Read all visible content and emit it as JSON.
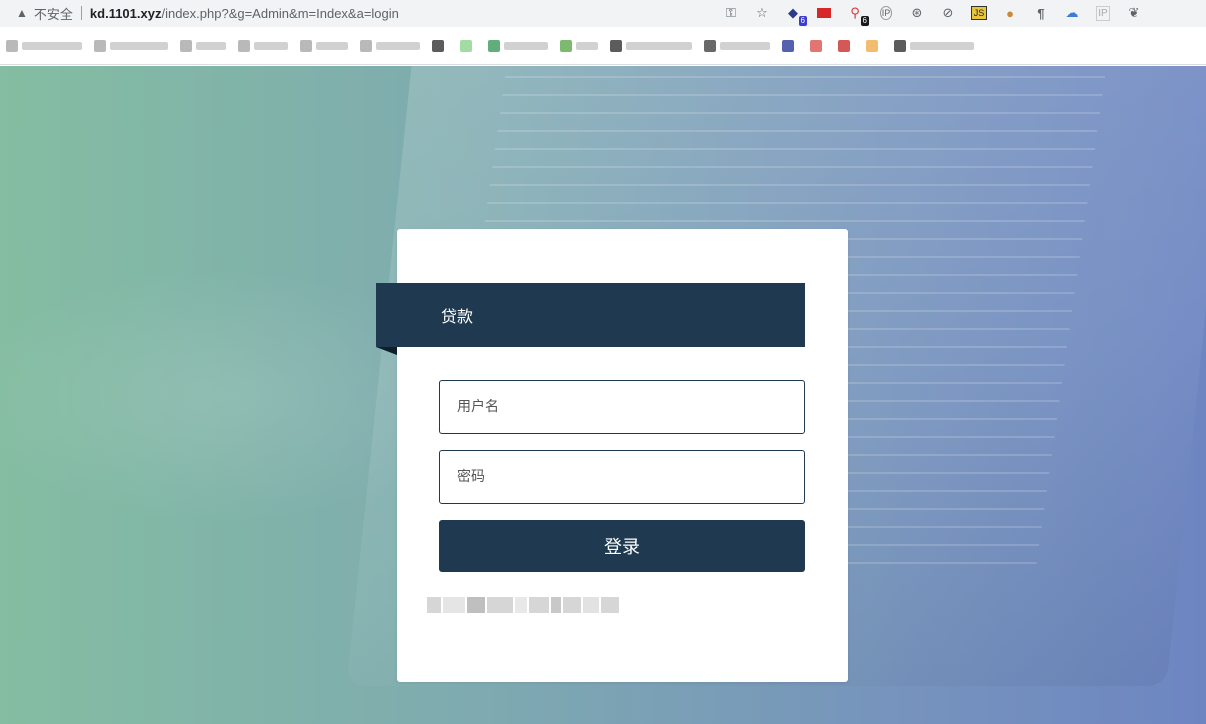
{
  "browser": {
    "security_label": "不安全",
    "url_host": "kd.1101.xyz",
    "url_path": "/index.php?&g=Admin&m=Index&a=login",
    "toolbar_icons": [
      "key-icon",
      "star-icon",
      "extension-diamond-icon",
      "extension-flag-icon",
      "extension-pin-icon",
      "extension-ip-icon",
      "extension-globe-icon",
      "extension-ban-icon",
      "extension-js-icon",
      "extension-cookie-icon",
      "extension-pilcrow-icon",
      "extension-cloud-icon",
      "extension-ip2-icon",
      "evernote-icon"
    ],
    "badge_counts": [
      "6",
      "6"
    ],
    "toolbar_glyphs": {
      "ip": "IP",
      "js": "JS",
      "pilcrow": "¶"
    }
  },
  "login": {
    "title": "贷款",
    "username_placeholder": "用户名",
    "password_placeholder": "密码",
    "submit_label": "登录"
  },
  "colors": {
    "accent": "#1f3a50",
    "background_start": "#84bda2",
    "background_end": "#6d86c2"
  }
}
